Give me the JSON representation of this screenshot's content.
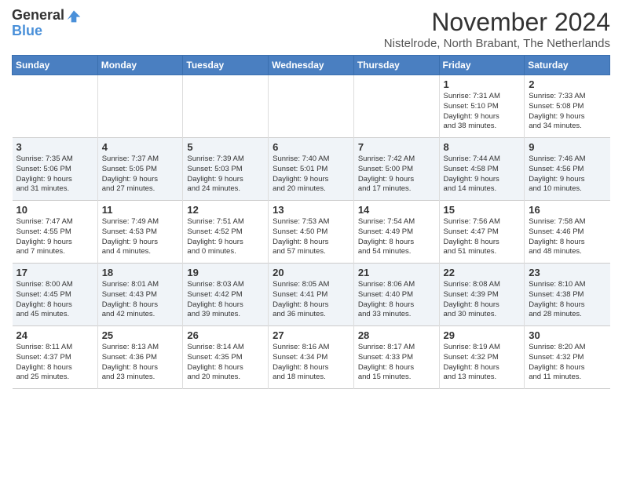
{
  "logo": {
    "line1": "General",
    "line2": "Blue"
  },
  "title": "November 2024",
  "subtitle": "Nistelrode, North Brabant, The Netherlands",
  "days_of_week": [
    "Sunday",
    "Monday",
    "Tuesday",
    "Wednesday",
    "Thursday",
    "Friday",
    "Saturday"
  ],
  "weeks": [
    [
      {
        "num": "",
        "info": ""
      },
      {
        "num": "",
        "info": ""
      },
      {
        "num": "",
        "info": ""
      },
      {
        "num": "",
        "info": ""
      },
      {
        "num": "",
        "info": ""
      },
      {
        "num": "1",
        "info": "Sunrise: 7:31 AM\nSunset: 5:10 PM\nDaylight: 9 hours\nand 38 minutes."
      },
      {
        "num": "2",
        "info": "Sunrise: 7:33 AM\nSunset: 5:08 PM\nDaylight: 9 hours\nand 34 minutes."
      }
    ],
    [
      {
        "num": "3",
        "info": "Sunrise: 7:35 AM\nSunset: 5:06 PM\nDaylight: 9 hours\nand 31 minutes."
      },
      {
        "num": "4",
        "info": "Sunrise: 7:37 AM\nSunset: 5:05 PM\nDaylight: 9 hours\nand 27 minutes."
      },
      {
        "num": "5",
        "info": "Sunrise: 7:39 AM\nSunset: 5:03 PM\nDaylight: 9 hours\nand 24 minutes."
      },
      {
        "num": "6",
        "info": "Sunrise: 7:40 AM\nSunset: 5:01 PM\nDaylight: 9 hours\nand 20 minutes."
      },
      {
        "num": "7",
        "info": "Sunrise: 7:42 AM\nSunset: 5:00 PM\nDaylight: 9 hours\nand 17 minutes."
      },
      {
        "num": "8",
        "info": "Sunrise: 7:44 AM\nSunset: 4:58 PM\nDaylight: 9 hours\nand 14 minutes."
      },
      {
        "num": "9",
        "info": "Sunrise: 7:46 AM\nSunset: 4:56 PM\nDaylight: 9 hours\nand 10 minutes."
      }
    ],
    [
      {
        "num": "10",
        "info": "Sunrise: 7:47 AM\nSunset: 4:55 PM\nDaylight: 9 hours\nand 7 minutes."
      },
      {
        "num": "11",
        "info": "Sunrise: 7:49 AM\nSunset: 4:53 PM\nDaylight: 9 hours\nand 4 minutes."
      },
      {
        "num": "12",
        "info": "Sunrise: 7:51 AM\nSunset: 4:52 PM\nDaylight: 9 hours\nand 0 minutes."
      },
      {
        "num": "13",
        "info": "Sunrise: 7:53 AM\nSunset: 4:50 PM\nDaylight: 8 hours\nand 57 minutes."
      },
      {
        "num": "14",
        "info": "Sunrise: 7:54 AM\nSunset: 4:49 PM\nDaylight: 8 hours\nand 54 minutes."
      },
      {
        "num": "15",
        "info": "Sunrise: 7:56 AM\nSunset: 4:47 PM\nDaylight: 8 hours\nand 51 minutes."
      },
      {
        "num": "16",
        "info": "Sunrise: 7:58 AM\nSunset: 4:46 PM\nDaylight: 8 hours\nand 48 minutes."
      }
    ],
    [
      {
        "num": "17",
        "info": "Sunrise: 8:00 AM\nSunset: 4:45 PM\nDaylight: 8 hours\nand 45 minutes."
      },
      {
        "num": "18",
        "info": "Sunrise: 8:01 AM\nSunset: 4:43 PM\nDaylight: 8 hours\nand 42 minutes."
      },
      {
        "num": "19",
        "info": "Sunrise: 8:03 AM\nSunset: 4:42 PM\nDaylight: 8 hours\nand 39 minutes."
      },
      {
        "num": "20",
        "info": "Sunrise: 8:05 AM\nSunset: 4:41 PM\nDaylight: 8 hours\nand 36 minutes."
      },
      {
        "num": "21",
        "info": "Sunrise: 8:06 AM\nSunset: 4:40 PM\nDaylight: 8 hours\nand 33 minutes."
      },
      {
        "num": "22",
        "info": "Sunrise: 8:08 AM\nSunset: 4:39 PM\nDaylight: 8 hours\nand 30 minutes."
      },
      {
        "num": "23",
        "info": "Sunrise: 8:10 AM\nSunset: 4:38 PM\nDaylight: 8 hours\nand 28 minutes."
      }
    ],
    [
      {
        "num": "24",
        "info": "Sunrise: 8:11 AM\nSunset: 4:37 PM\nDaylight: 8 hours\nand 25 minutes."
      },
      {
        "num": "25",
        "info": "Sunrise: 8:13 AM\nSunset: 4:36 PM\nDaylight: 8 hours\nand 23 minutes."
      },
      {
        "num": "26",
        "info": "Sunrise: 8:14 AM\nSunset: 4:35 PM\nDaylight: 8 hours\nand 20 minutes."
      },
      {
        "num": "27",
        "info": "Sunrise: 8:16 AM\nSunset: 4:34 PM\nDaylight: 8 hours\nand 18 minutes."
      },
      {
        "num": "28",
        "info": "Sunrise: 8:17 AM\nSunset: 4:33 PM\nDaylight: 8 hours\nand 15 minutes."
      },
      {
        "num": "29",
        "info": "Sunrise: 8:19 AM\nSunset: 4:32 PM\nDaylight: 8 hours\nand 13 minutes."
      },
      {
        "num": "30",
        "info": "Sunrise: 8:20 AM\nSunset: 4:32 PM\nDaylight: 8 hours\nand 11 minutes."
      }
    ]
  ]
}
